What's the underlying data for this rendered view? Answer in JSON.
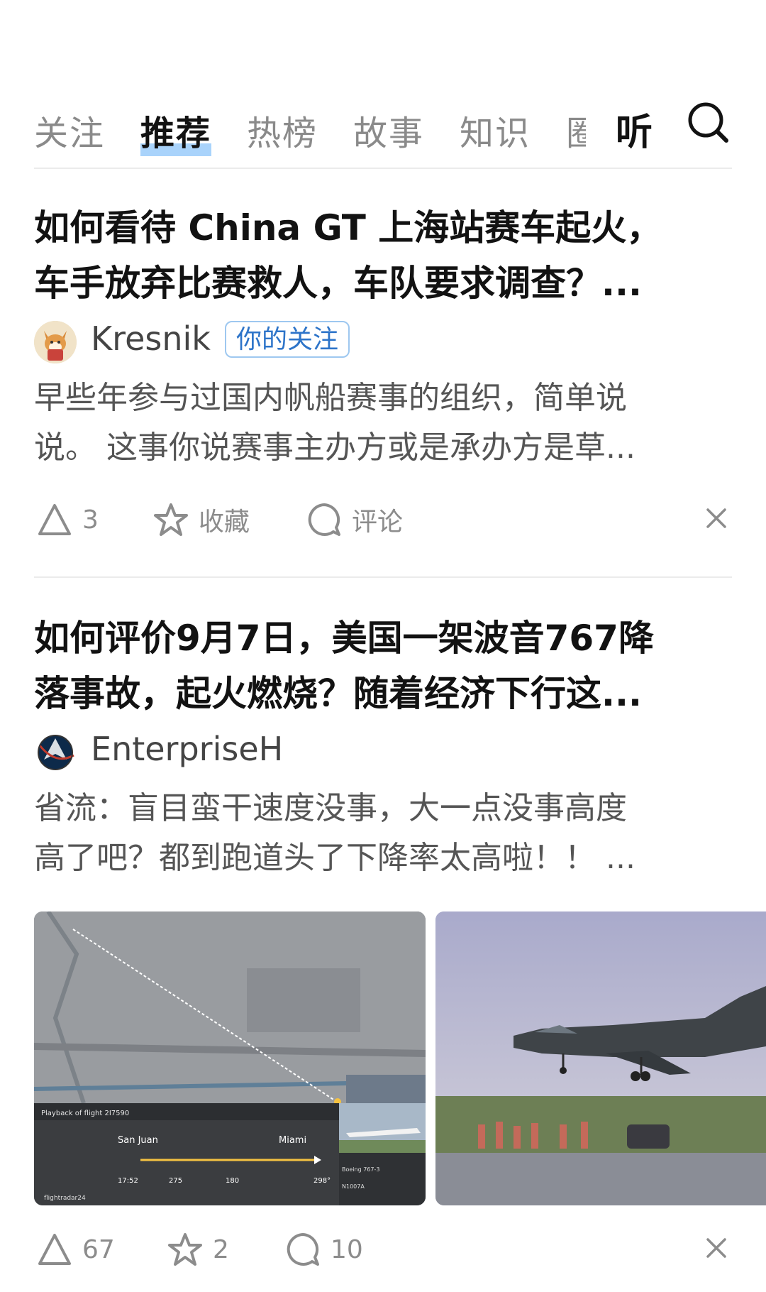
{
  "tabs": {
    "items": [
      "关注",
      "推荐",
      "热榜",
      "故事",
      "知识"
    ],
    "partial": "圈",
    "active_index": 1,
    "listen": "听"
  },
  "cards": [
    {
      "title_lines": [
        "如何看待 China GT 上海站赛车起火，",
        "车手放弃比赛救人，车队要求调查？..."
      ],
      "author": "Kresnik",
      "badge": "你的关注",
      "excerpt_lines": [
        "早些年参与过国内帆船赛事的组织，简单说",
        "说。 这事你说赛事主办方或是承办方是草..."
      ],
      "actions": {
        "upvote": "3",
        "favorite": "收藏",
        "comment": "评论"
      }
    },
    {
      "title_lines": [
        "如何评价9月7日，美国一架波音767降",
        "落事故，起火燃烧？随着经济下行这..."
      ],
      "author": "EnterpriseH",
      "excerpt_lines": [
        "省流：盲目蛮干速度没事，大一点没事高度",
        "高了吧？都到跑道头了下降率太高啦！！ ..."
      ],
      "images": {
        "flight_panel": {
          "header": "Playback of flight 2I7590",
          "from": "San Juan",
          "to": "Miami",
          "brand": "flightradar24",
          "time": "17:52",
          "altitude": "275",
          "speed": "180",
          "track": "298°",
          "aircraft": "Boeing 767-3",
          "registration": "N1007A"
        }
      },
      "actions": {
        "upvote": "67",
        "favorite": "2",
        "comment": "10"
      }
    }
  ],
  "colors": {
    "tab_highlight": "#a9d3fb",
    "badge_text": "#2d74c9",
    "divider": "#ebebeb"
  }
}
